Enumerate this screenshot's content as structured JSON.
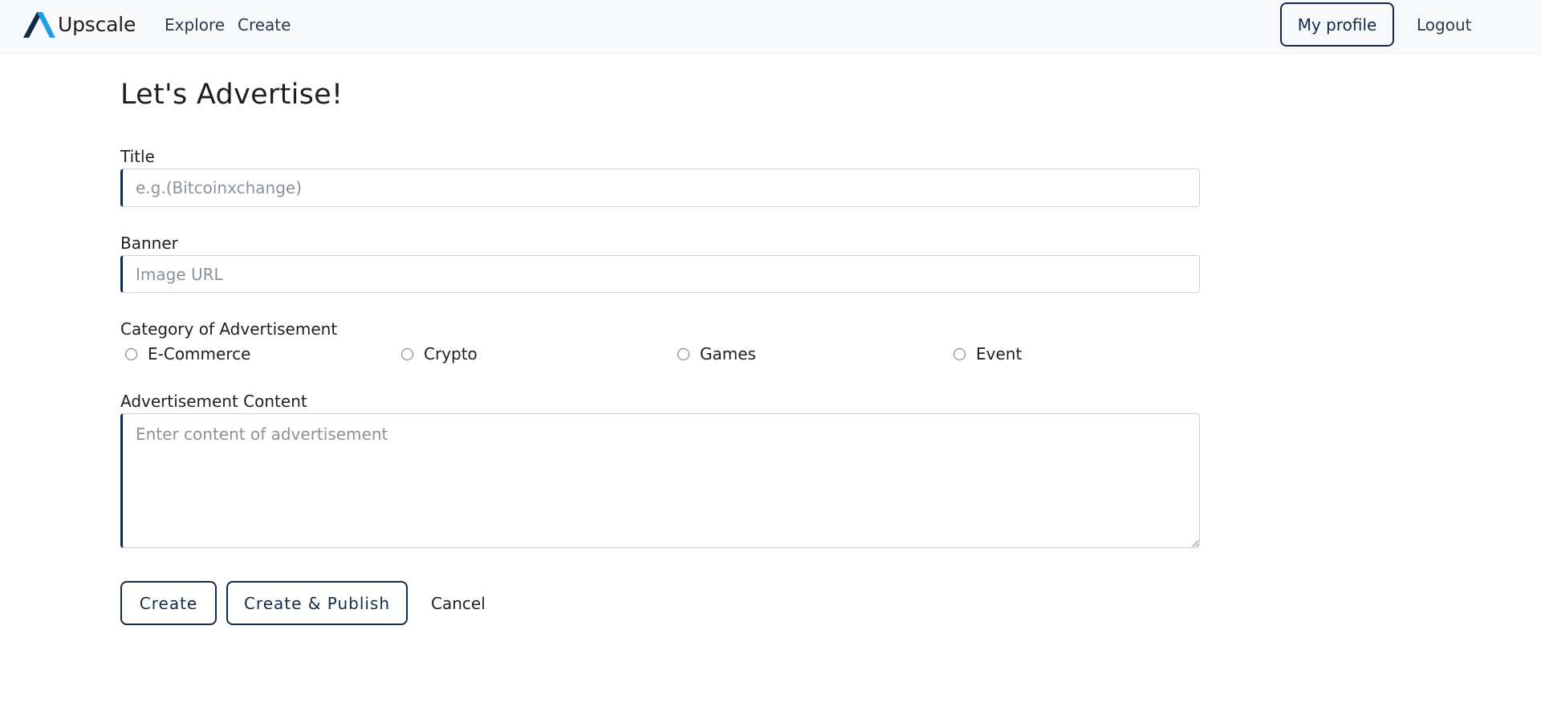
{
  "navbar": {
    "brand_name": "Upscale",
    "links": {
      "explore": "Explore",
      "create": "Create"
    },
    "profile_button": "My profile",
    "logout": "Logout",
    "colors": {
      "background": "#f8f9fa",
      "brand_dark": "#0f2a4a",
      "brand_light": "#1fa0e6"
    }
  },
  "form": {
    "heading": "Let's Advertise!",
    "title_label": "Title",
    "title_placeholder": "e.g.(Bitcoinxchange)",
    "title_value": "",
    "banner_label": "Banner",
    "banner_placeholder": "Image URL",
    "banner_value": "",
    "category_label": "Category of Advertisement",
    "category_options": [
      "E-Commerce",
      "Crypto",
      "Games",
      "Event"
    ],
    "category_selected": null,
    "content_label": "Advertisement Content",
    "content_placeholder": "Enter content of advertisement",
    "content_value": "",
    "buttons": {
      "create": "Create",
      "create_publish": "Create & Publish",
      "cancel": "Cancel"
    }
  },
  "icons": {
    "brand_logo": "upscale-logo-icon"
  }
}
